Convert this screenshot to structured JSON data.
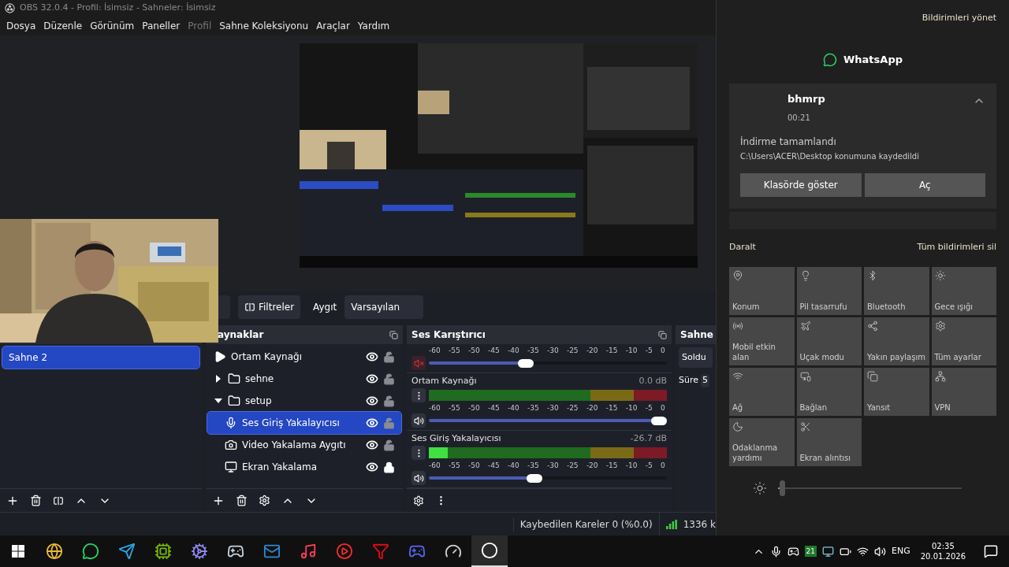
{
  "window": {
    "title": "OBS 32.0.4 - Profil: İsimsiz - Sahneler: İsimsiz"
  },
  "menu": [
    {
      "label": "Dosya",
      "disabled": false
    },
    {
      "label": "Düzenle",
      "disabled": false
    },
    {
      "label": "Görünüm",
      "disabled": false
    },
    {
      "label": "Paneller",
      "disabled": false
    },
    {
      "label": "Profil",
      "disabled": true
    },
    {
      "label": "Sahne Koleksiyonu",
      "disabled": false
    },
    {
      "label": "Araçlar",
      "disabled": false
    },
    {
      "label": "Yardım",
      "disabled": false
    }
  ],
  "source_toolbar": {
    "filters_button": "Filtreler",
    "device_label": "Aygıt",
    "device_value": "Varsayılan"
  },
  "scenes": [
    {
      "name": "Sahne 2",
      "selected": true
    }
  ],
  "sources": {
    "title": "aynaklar",
    "items": [
      {
        "name": "Ortam Kaynağı",
        "kind": "media",
        "selected": false,
        "visible": true,
        "locked": false
      },
      {
        "name": "sehne",
        "kind": "group",
        "expanded": false,
        "selected": false,
        "visible": true,
        "locked": false
      },
      {
        "name": "setup",
        "kind": "group",
        "expanded": true,
        "selected": false,
        "visible": true,
        "locked": false,
        "children": [
          {
            "name": "Ses Giriş Yakalayıcısı",
            "kind": "audio_input",
            "selected": true,
            "visible": true,
            "locked": false
          },
          {
            "name": "Video Yakalama Aygıtı",
            "kind": "video_capture",
            "selected": false,
            "visible": true,
            "locked": false
          },
          {
            "name": "Ekran Yakalama",
            "kind": "display_capture",
            "selected": false,
            "visible": true,
            "locked": true
          }
        ]
      }
    ]
  },
  "mixer": {
    "title": "Ses Karıştırıcı",
    "channels": [
      {
        "muted": true,
        "scale": [
          "-60",
          "-55",
          "-50",
          "-45",
          "-40",
          "-35",
          "-30",
          "-25",
          "-20",
          "-15",
          "-10",
          "-5",
          "0"
        ],
        "volume": {
          "level": 0.4
        }
      },
      {
        "name": "Ortam Kaynağı",
        "reading": "0.0 dB",
        "muted": false,
        "scale": [
          "-60",
          "-55",
          "-50",
          "-45",
          "-40",
          "-35",
          "-30",
          "-25",
          "-20",
          "-15",
          "-10",
          "-5",
          "0"
        ],
        "volume": {
          "level": 1
        }
      },
      {
        "name": "Ses Giriş Yakalayıcısı",
        "reading": "-26.7 dB",
        "muted": false,
        "meter": {
          "level": 0.08
        },
        "scale": [
          "-60",
          "-55",
          "-50",
          "-45",
          "-40",
          "-35",
          "-30",
          "-25",
          "-20",
          "-15",
          "-10",
          "-5",
          "0"
        ],
        "volume": {
          "level": 0.44
        }
      }
    ]
  },
  "transitions": {
    "title": "Sahne",
    "transition": "Soldu",
    "duration_label": "Süre",
    "duration_value": "5"
  },
  "status_bar": {
    "dropped_frames": "Kaybedilen Kareler 0 (%0.0)",
    "bitrate": "1336 k"
  },
  "notifications": {
    "manage": "Bildirimleri yönet",
    "app": "WhatsApp",
    "card": {
      "sender": "bhmrp",
      "time": "00:21",
      "expanded": true,
      "title": "İndirme tamamlandı",
      "body": "C:\\Users\\ACER\\Desktop konumuna kaydedildi",
      "actions": [
        "Klasörde göster",
        "Aç"
      ]
    },
    "collapse": "Daralt",
    "clear_all": "Tüm bildirimleri sil"
  },
  "quick_actions": [
    {
      "label": "Konum",
      "on": false
    },
    {
      "label": "Pil tasarrufu",
      "on": false
    },
    {
      "label": "Bluetooth",
      "on": false
    },
    {
      "label": "Gece ışığı",
      "on": false
    },
    {
      "label": "Mobil etkin alan",
      "on": false
    },
    {
      "label": "Uçak modu",
      "on": false
    },
    {
      "label": "Yakın paylaşım",
      "on": false
    },
    {
      "label": "Tüm ayarlar",
      "on": false
    },
    {
      "label": "Ağ",
      "on": false
    },
    {
      "label": "Bağlan",
      "on": false
    },
    {
      "label": "Yansıt",
      "on": false
    },
    {
      "label": "VPN",
      "on": false
    },
    {
      "label": "Odaklanma yardımı",
      "on": false
    },
    {
      "label": "Ekran alıntısı",
      "on": false
    }
  ],
  "brightness": {
    "level": 0.02
  },
  "taskbar": {
    "tray_badge": "21",
    "language": "ENG",
    "time": "02:35",
    "date": "20.01.2026"
  }
}
